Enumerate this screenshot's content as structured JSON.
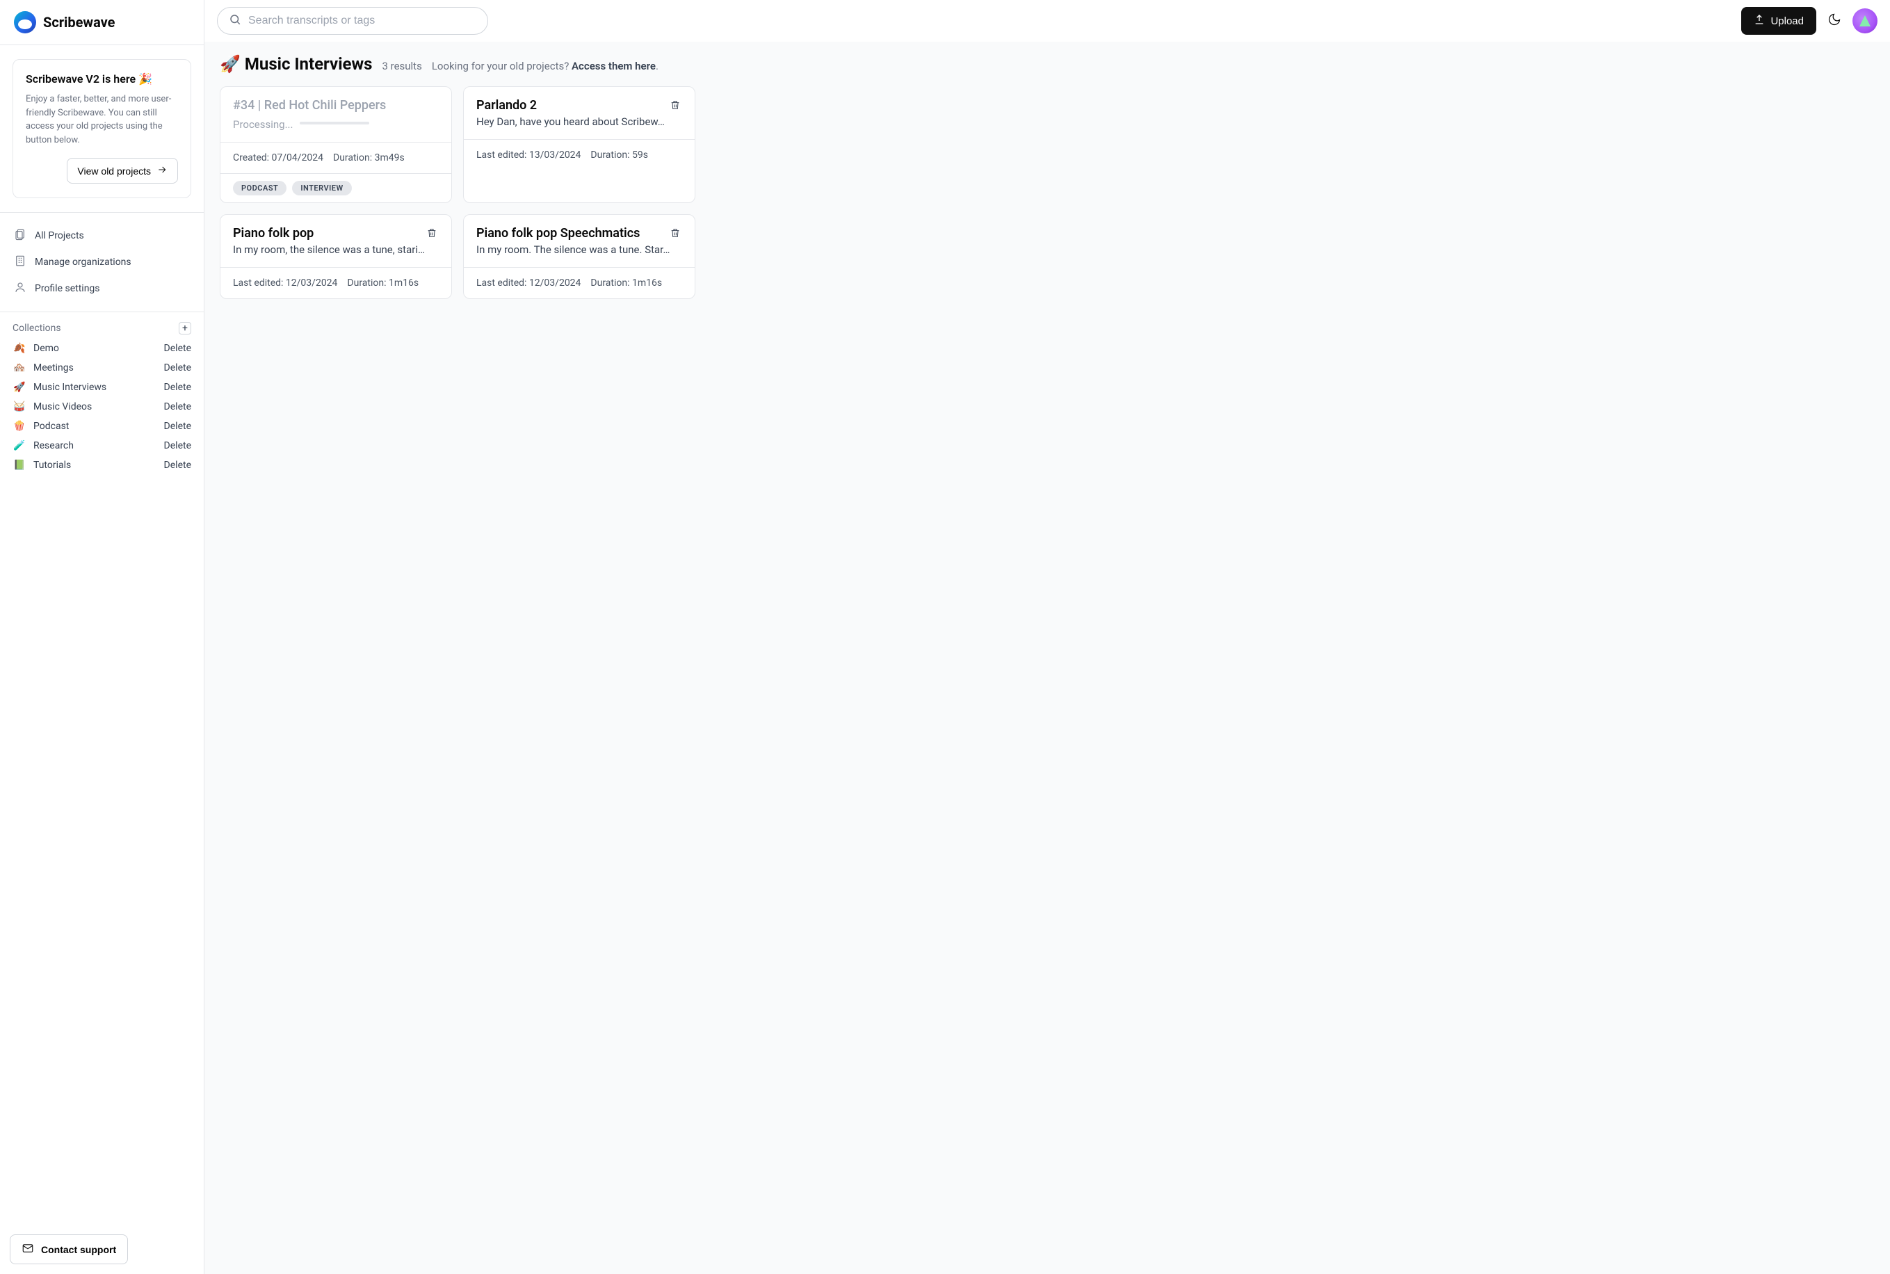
{
  "brand": "Scribewave",
  "promo": {
    "title": "Scribewave V2 is here 🎉",
    "body": "Enjoy a faster, better, and more user-friendly Scribewave.\nYou can still access your old projects using the button below.",
    "button": "View old projects"
  },
  "nav": {
    "all_projects": "All Projects",
    "manage_orgs": "Manage organizations",
    "profile_settings": "Profile settings"
  },
  "collections": {
    "label": "Collections",
    "delete_label": "Delete",
    "items": [
      {
        "emoji": "🍂",
        "name": "Demo"
      },
      {
        "emoji": "🏘️",
        "name": "Meetings"
      },
      {
        "emoji": "🚀",
        "name": "Music Interviews"
      },
      {
        "emoji": "🥁",
        "name": "Music Videos"
      },
      {
        "emoji": "🍿",
        "name": "Podcast"
      },
      {
        "emoji": "🧪",
        "name": "Research"
      },
      {
        "emoji": "📗",
        "name": "Tutorials"
      }
    ]
  },
  "contact_support": "Contact support",
  "search": {
    "placeholder": "Search transcripts or tags"
  },
  "upload_label": "Upload",
  "header": {
    "emoji": "🚀",
    "title": "Music Interviews",
    "results": "3 results",
    "old_prompt": "Looking for your old projects? ",
    "old_link": "Access them here",
    "period": "."
  },
  "cards": [
    {
      "title": "#34 | Red Hot Chili Peppers",
      "processing": "Processing...",
      "meta_left_label": "Created: ",
      "meta_left_value": "07/04/2024",
      "meta_right_label": "Duration: ",
      "meta_right_value": "3m49s",
      "tags": [
        "PODCAST",
        "INTERVIEW"
      ]
    },
    {
      "title": "Parlando 2",
      "subtitle": "Hey Dan, have you heard about Scribew…",
      "meta_left_label": "Last edited: ",
      "meta_left_value": "13/03/2024",
      "meta_right_label": "Duration: ",
      "meta_right_value": "59s"
    },
    {
      "title": "Piano folk pop",
      "subtitle": "In my room, the silence was a tune, stari…",
      "meta_left_label": "Last edited: ",
      "meta_left_value": "12/03/2024",
      "meta_right_label": "Duration: ",
      "meta_right_value": "1m16s"
    },
    {
      "title": "Piano folk pop Speechmatics",
      "subtitle": "In my room. The silence was a tune. Star…",
      "meta_left_label": "Last edited: ",
      "meta_left_value": "12/03/2024",
      "meta_right_label": "Duration: ",
      "meta_right_value": "1m16s"
    }
  ]
}
